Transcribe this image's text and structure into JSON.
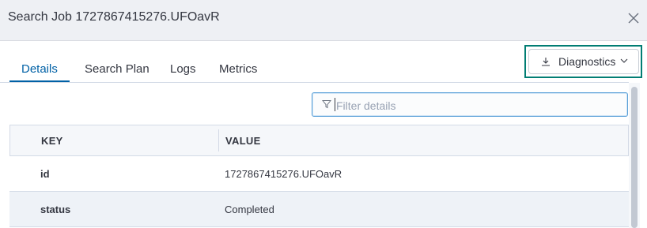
{
  "header": {
    "title": "Search Job 1727867415276.UFOavR"
  },
  "tabs": [
    {
      "label": "Details"
    },
    {
      "label": "Search Plan"
    },
    {
      "label": "Logs"
    },
    {
      "label": "Metrics"
    }
  ],
  "active_tab": "Details",
  "diagnostics": {
    "label": "Diagnostics"
  },
  "filter": {
    "placeholder": "Filter details",
    "value": ""
  },
  "table": {
    "columns": [
      "KEY",
      "VALUE"
    ],
    "rows": [
      {
        "key": "id",
        "value": "1727867415276.UFOavR"
      },
      {
        "key": "status",
        "value": "Completed"
      }
    ]
  },
  "icons": {
    "close": "close-icon",
    "download": "download-icon",
    "chevron": "chevron-down-icon",
    "filter": "filter-icon"
  },
  "colors": {
    "accent": "#0061a6",
    "highlight": "#017d73",
    "header_bg": "#eef0f4"
  }
}
